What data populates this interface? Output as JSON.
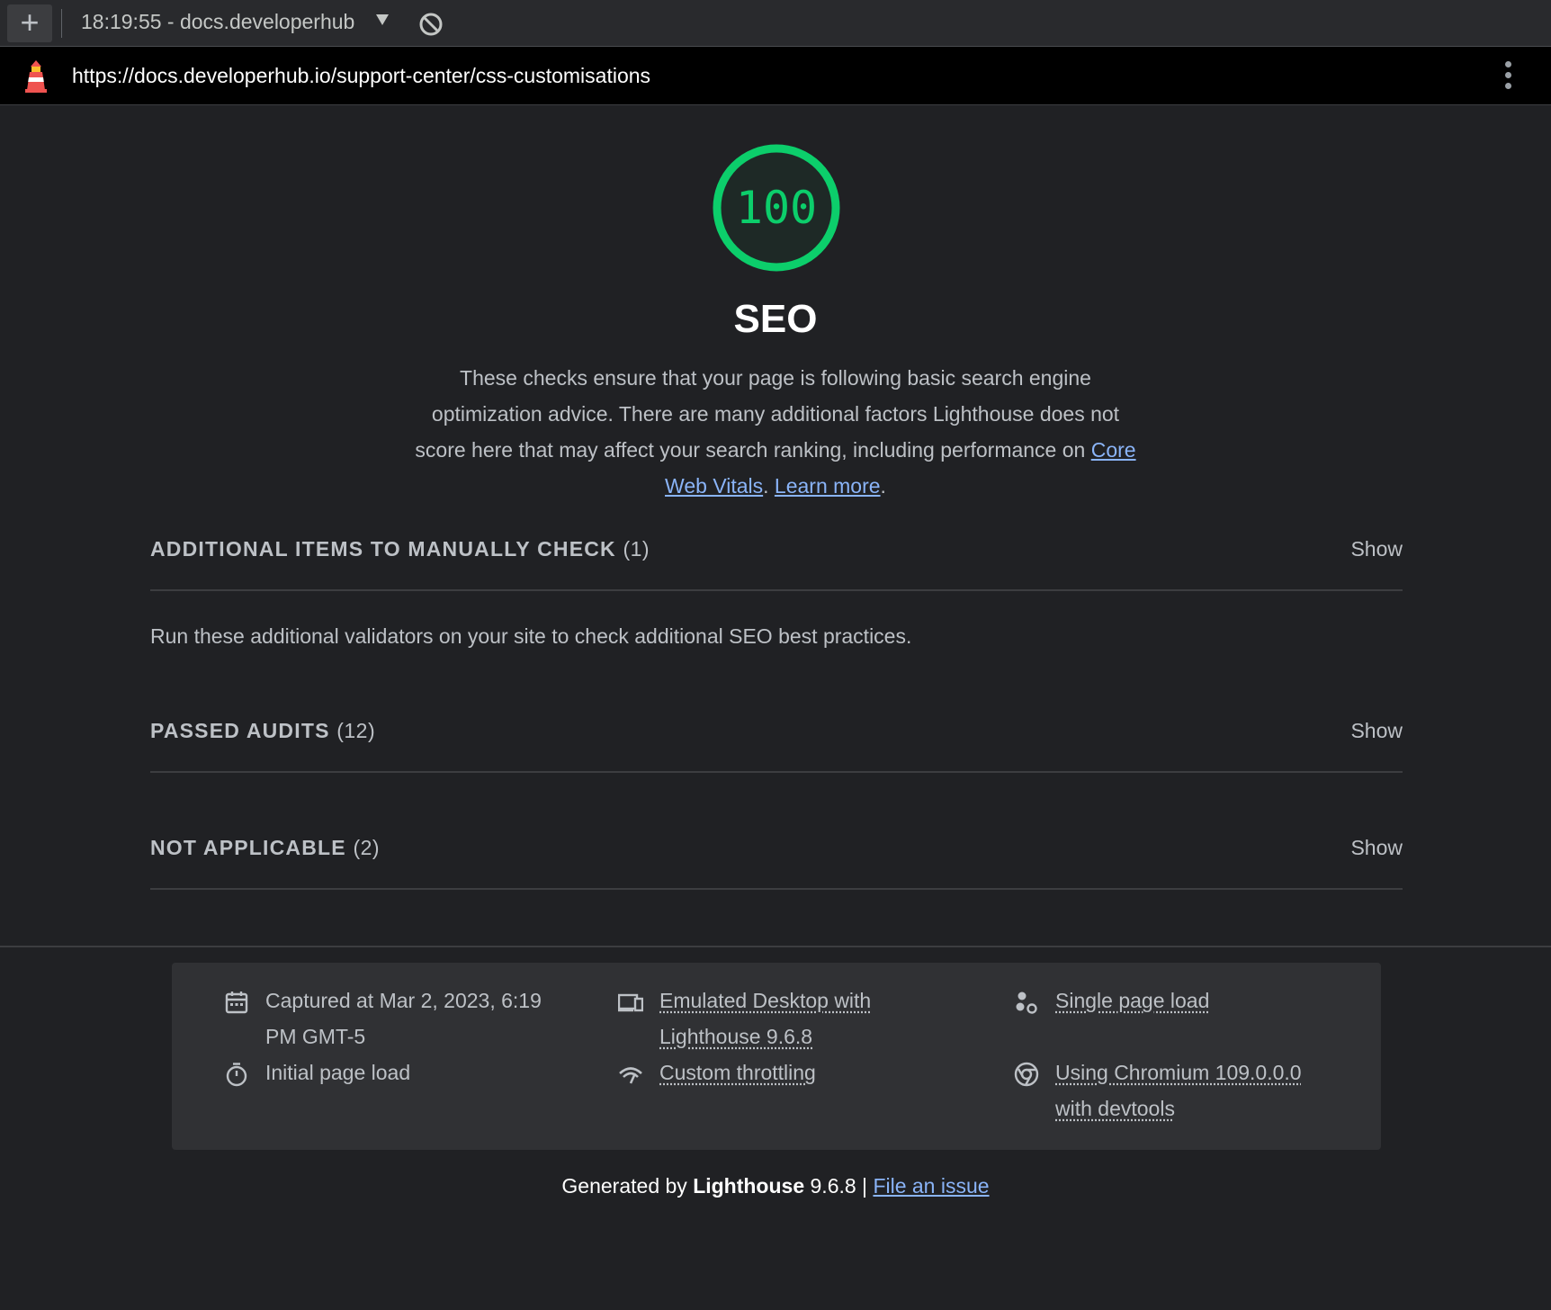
{
  "toolbar": {
    "new_report_icon": "plus-icon",
    "report_label": "18:19:55 - docs.developerhub",
    "dropdown_icon": "caret-down-icon",
    "clear_icon": "block-icon"
  },
  "urlbar": {
    "logo_icon": "lighthouse-icon",
    "url": "https://docs.developerhub.io/support-center/css-customisations",
    "menu_icon": "kebab-menu-icon"
  },
  "category": {
    "score": "100",
    "score_fraction": 1.0,
    "score_color": "#0cce6b",
    "title": "SEO",
    "description_part1": "These checks ensure that your page is following basic search engine optimization advice. There are many additional factors Lighthouse does not score here that may affect your search ranking, including performance on ",
    "link_core_web_vitals": "Core Web Vitals",
    "description_sep": ". ",
    "link_learn_more": "Learn more",
    "description_end": "."
  },
  "groups": [
    {
      "title": "Additional items to manually check",
      "count": "(1)",
      "show_label": "Show",
      "description": "Run these additional validators on your site to check additional SEO best practices."
    },
    {
      "title": "Passed audits",
      "count": "(12)",
      "show_label": "Show"
    },
    {
      "title": "Not applicable",
      "count": "(2)",
      "show_label": "Show"
    }
  ],
  "environment": {
    "captured_line1": "Captured at Mar 2, 2023, 6:19",
    "captured_line2": "PM GMT-5",
    "initial_load": "Initial page load",
    "device_line1": "Emulated Desktop with",
    "device_line2": "Lighthouse 9.6.8",
    "throttling": "Custom throttling",
    "single_load": "Single page load",
    "browser_line1": "Using Chromium 109.0.0.0",
    "browser_line2": "with devtools",
    "icons": {
      "captured": "calendar-icon",
      "initial_load": "stopwatch-icon",
      "device": "devices-icon",
      "throttling": "network-icon",
      "single_load": "people-icon",
      "browser": "chrome-icon"
    }
  },
  "footer": {
    "generated_by": "Generated by ",
    "product": "Lighthouse",
    "version": " 9.6.8 | ",
    "file_issue": "File an issue"
  }
}
